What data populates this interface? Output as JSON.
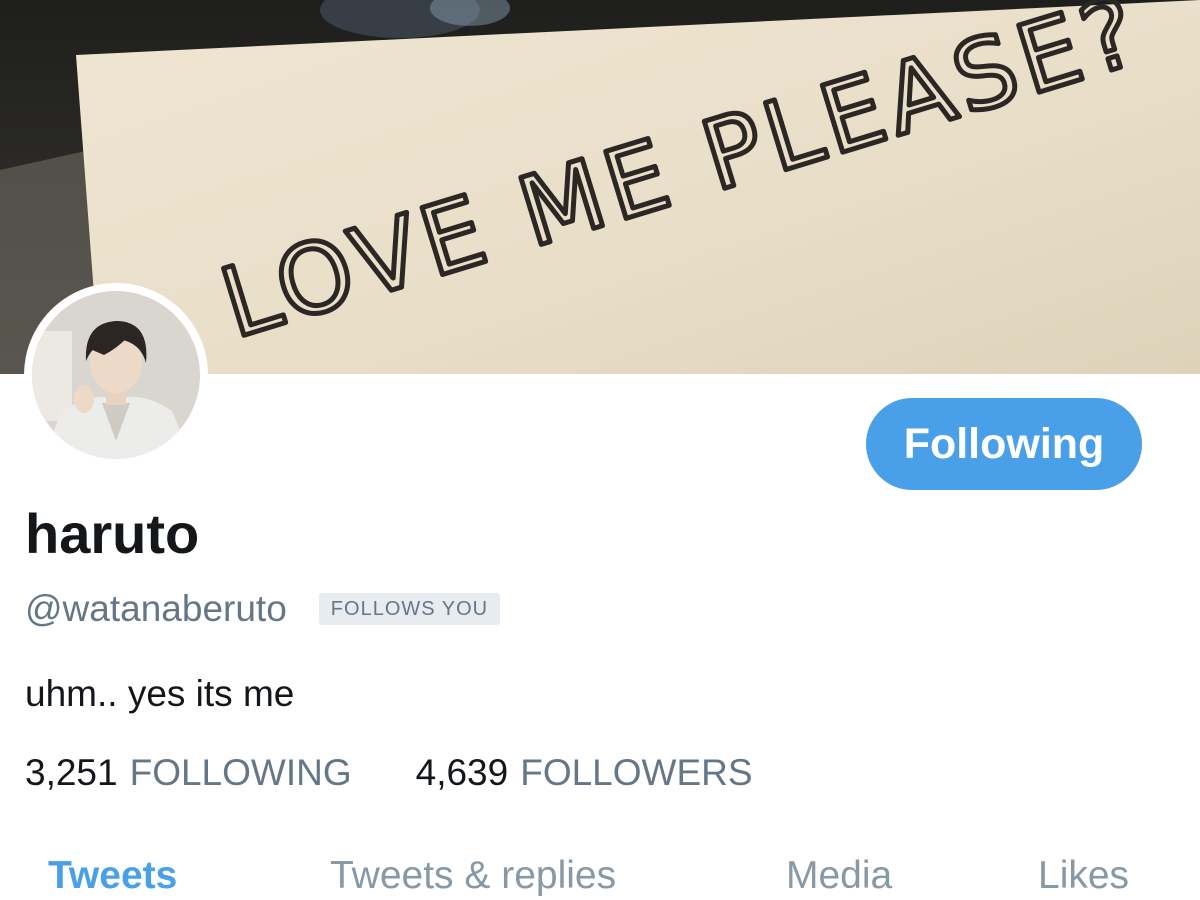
{
  "banner": {
    "note_text": "LOVE ME PLEASE?"
  },
  "profile": {
    "display_name": "haruto",
    "handle": "@watanaberuto",
    "follows_you_badge": "FOLLOWS YOU",
    "bio": "uhm.. yes its me",
    "follow_button_label": "Following"
  },
  "stats": {
    "following_count": "3,251",
    "following_label": "FOLLOWING",
    "followers_count": "4,639",
    "followers_label": "FOLLOWERS"
  },
  "tabs": [
    {
      "label": "Tweets",
      "active": true
    },
    {
      "label": "Tweets & replies",
      "active": false
    },
    {
      "label": "Media",
      "active": false
    },
    {
      "label": "Likes",
      "active": false
    }
  ],
  "colors": {
    "accent": "#4aa0e8",
    "muted": "#657786",
    "badge_bg": "#e6ecf0",
    "tab_inactive": "#8899a6"
  },
  "icons": {
    "avatar": "profile-photo",
    "banner": "banner-photo"
  }
}
